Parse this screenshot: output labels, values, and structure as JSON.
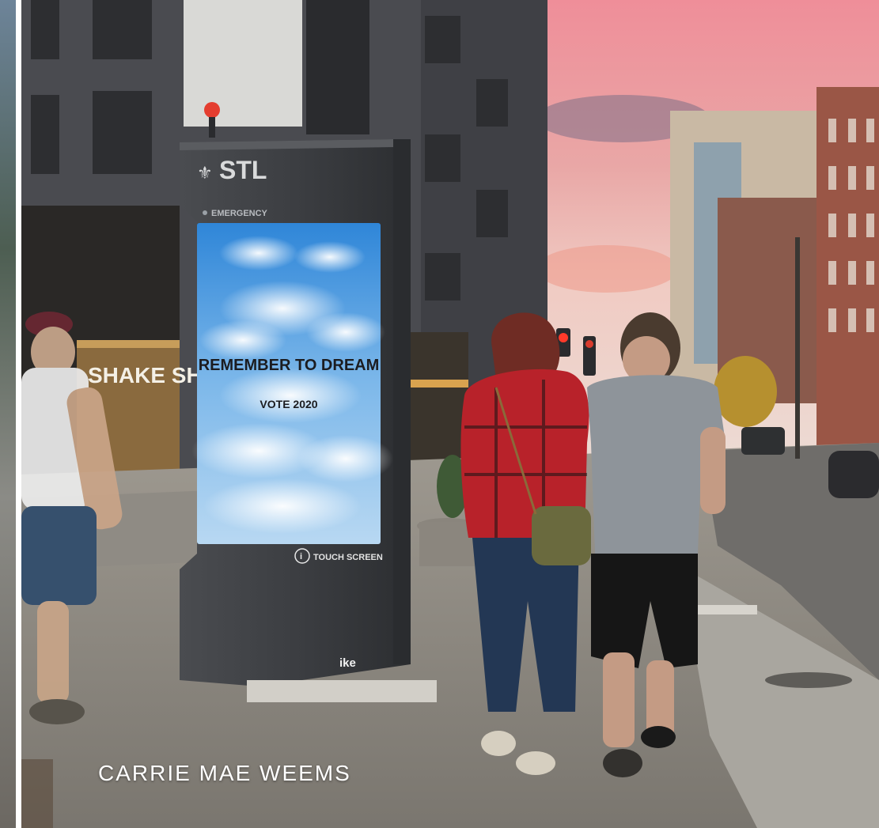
{
  "caption": "CARRIE MAE WEEMS",
  "kiosk": {
    "brand": "STL",
    "emergency_label": "EMERGENCY",
    "screen_headline": "REMEMBER TO DREAM",
    "screen_subline": "VOTE 2020",
    "touch_label": "TOUCH SCREEN",
    "maker_logo": "ike"
  },
  "storefront_sign": "SHAKE SH",
  "colors": {
    "sky_top": "#f28a92",
    "sky_bottom": "#f1d3cd",
    "kiosk_body": "#3d3f42",
    "screen_sky": "#4b9be0",
    "building": "#4a4b50"
  }
}
